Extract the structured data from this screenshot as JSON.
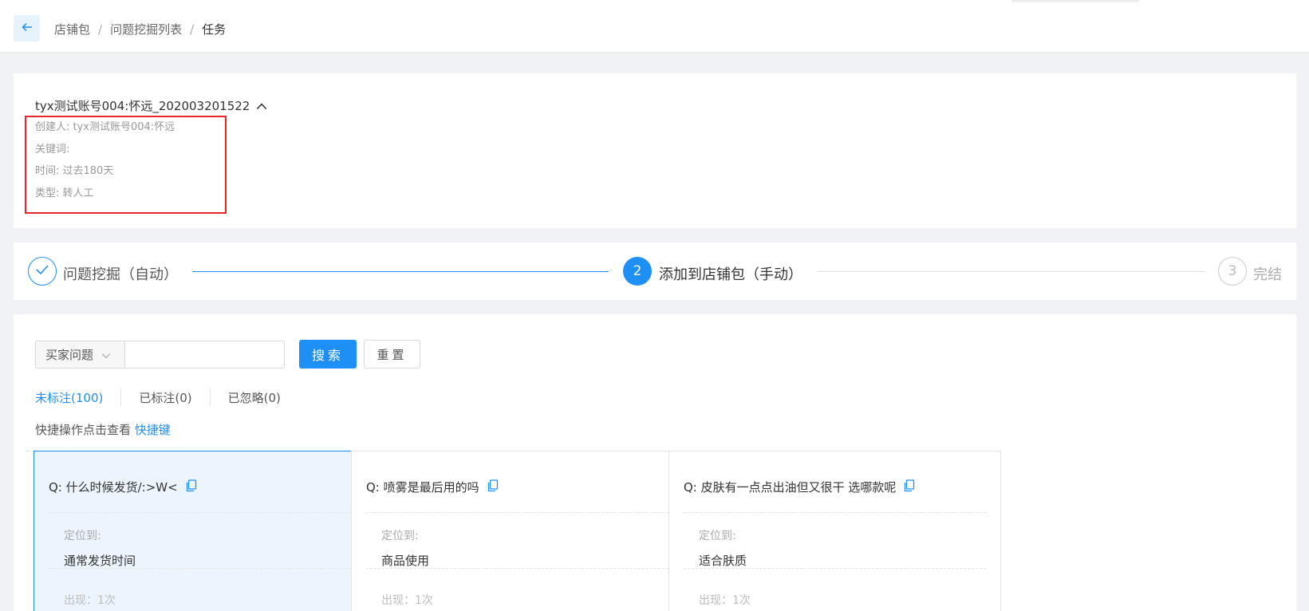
{
  "header": {
    "breadcrumb": [
      "店铺包",
      "问题挖掘列表",
      "任务"
    ],
    "separator": "/"
  },
  "task": {
    "title": "tyx测试账号004:怀远_202003201522",
    "creator": "创建人: tyx测试账号004:怀远",
    "keywords": "关键词:",
    "time": "时间: 过去180天",
    "type": "类型: 转人工"
  },
  "steps": [
    {
      "number": "",
      "label": "问题挖掘（自动）",
      "status": "done"
    },
    {
      "number": "2",
      "label": "添加到店铺包（手动）",
      "status": "active"
    },
    {
      "number": "3",
      "label": "完结",
      "status": "pending"
    }
  ],
  "filter": {
    "select_value": "买家问题",
    "input_placeholder": "",
    "search_label": "搜索",
    "reset_label": "重置"
  },
  "tabs": [
    {
      "label": "未标注(100)",
      "active": true
    },
    {
      "label": "已标注(0)",
      "active": false
    },
    {
      "label": "已忽略(0)",
      "active": false
    }
  ],
  "hint": {
    "text": "快捷操作点击查看",
    "link": "快捷键"
  },
  "questions": [
    {
      "q": "Q: 什么时候发货/:>W<",
      "locate_label": "定位到:",
      "locate_value": "通常发货时间",
      "count": "出现：1次",
      "selected": true
    },
    {
      "q": "Q: 喷雾是最后用的吗",
      "locate_label": "定位到:",
      "locate_value": "商品使用",
      "count": "出现：1次",
      "selected": false
    },
    {
      "q": "Q: 皮肤有一点点出油但又很干 选哪款呢",
      "locate_label": "定位到:",
      "locate_value": "适合肤质",
      "count": "出现：1次",
      "selected": false
    }
  ],
  "colors": {
    "accent": "#1e8ff5",
    "highlight_border": "#e8252b"
  },
  "icons": {
    "back": "arrow-left-icon",
    "caret": "caret-up-icon",
    "check": "check-icon",
    "chevron": "chevron-down-icon",
    "copy": "copy-icon"
  }
}
